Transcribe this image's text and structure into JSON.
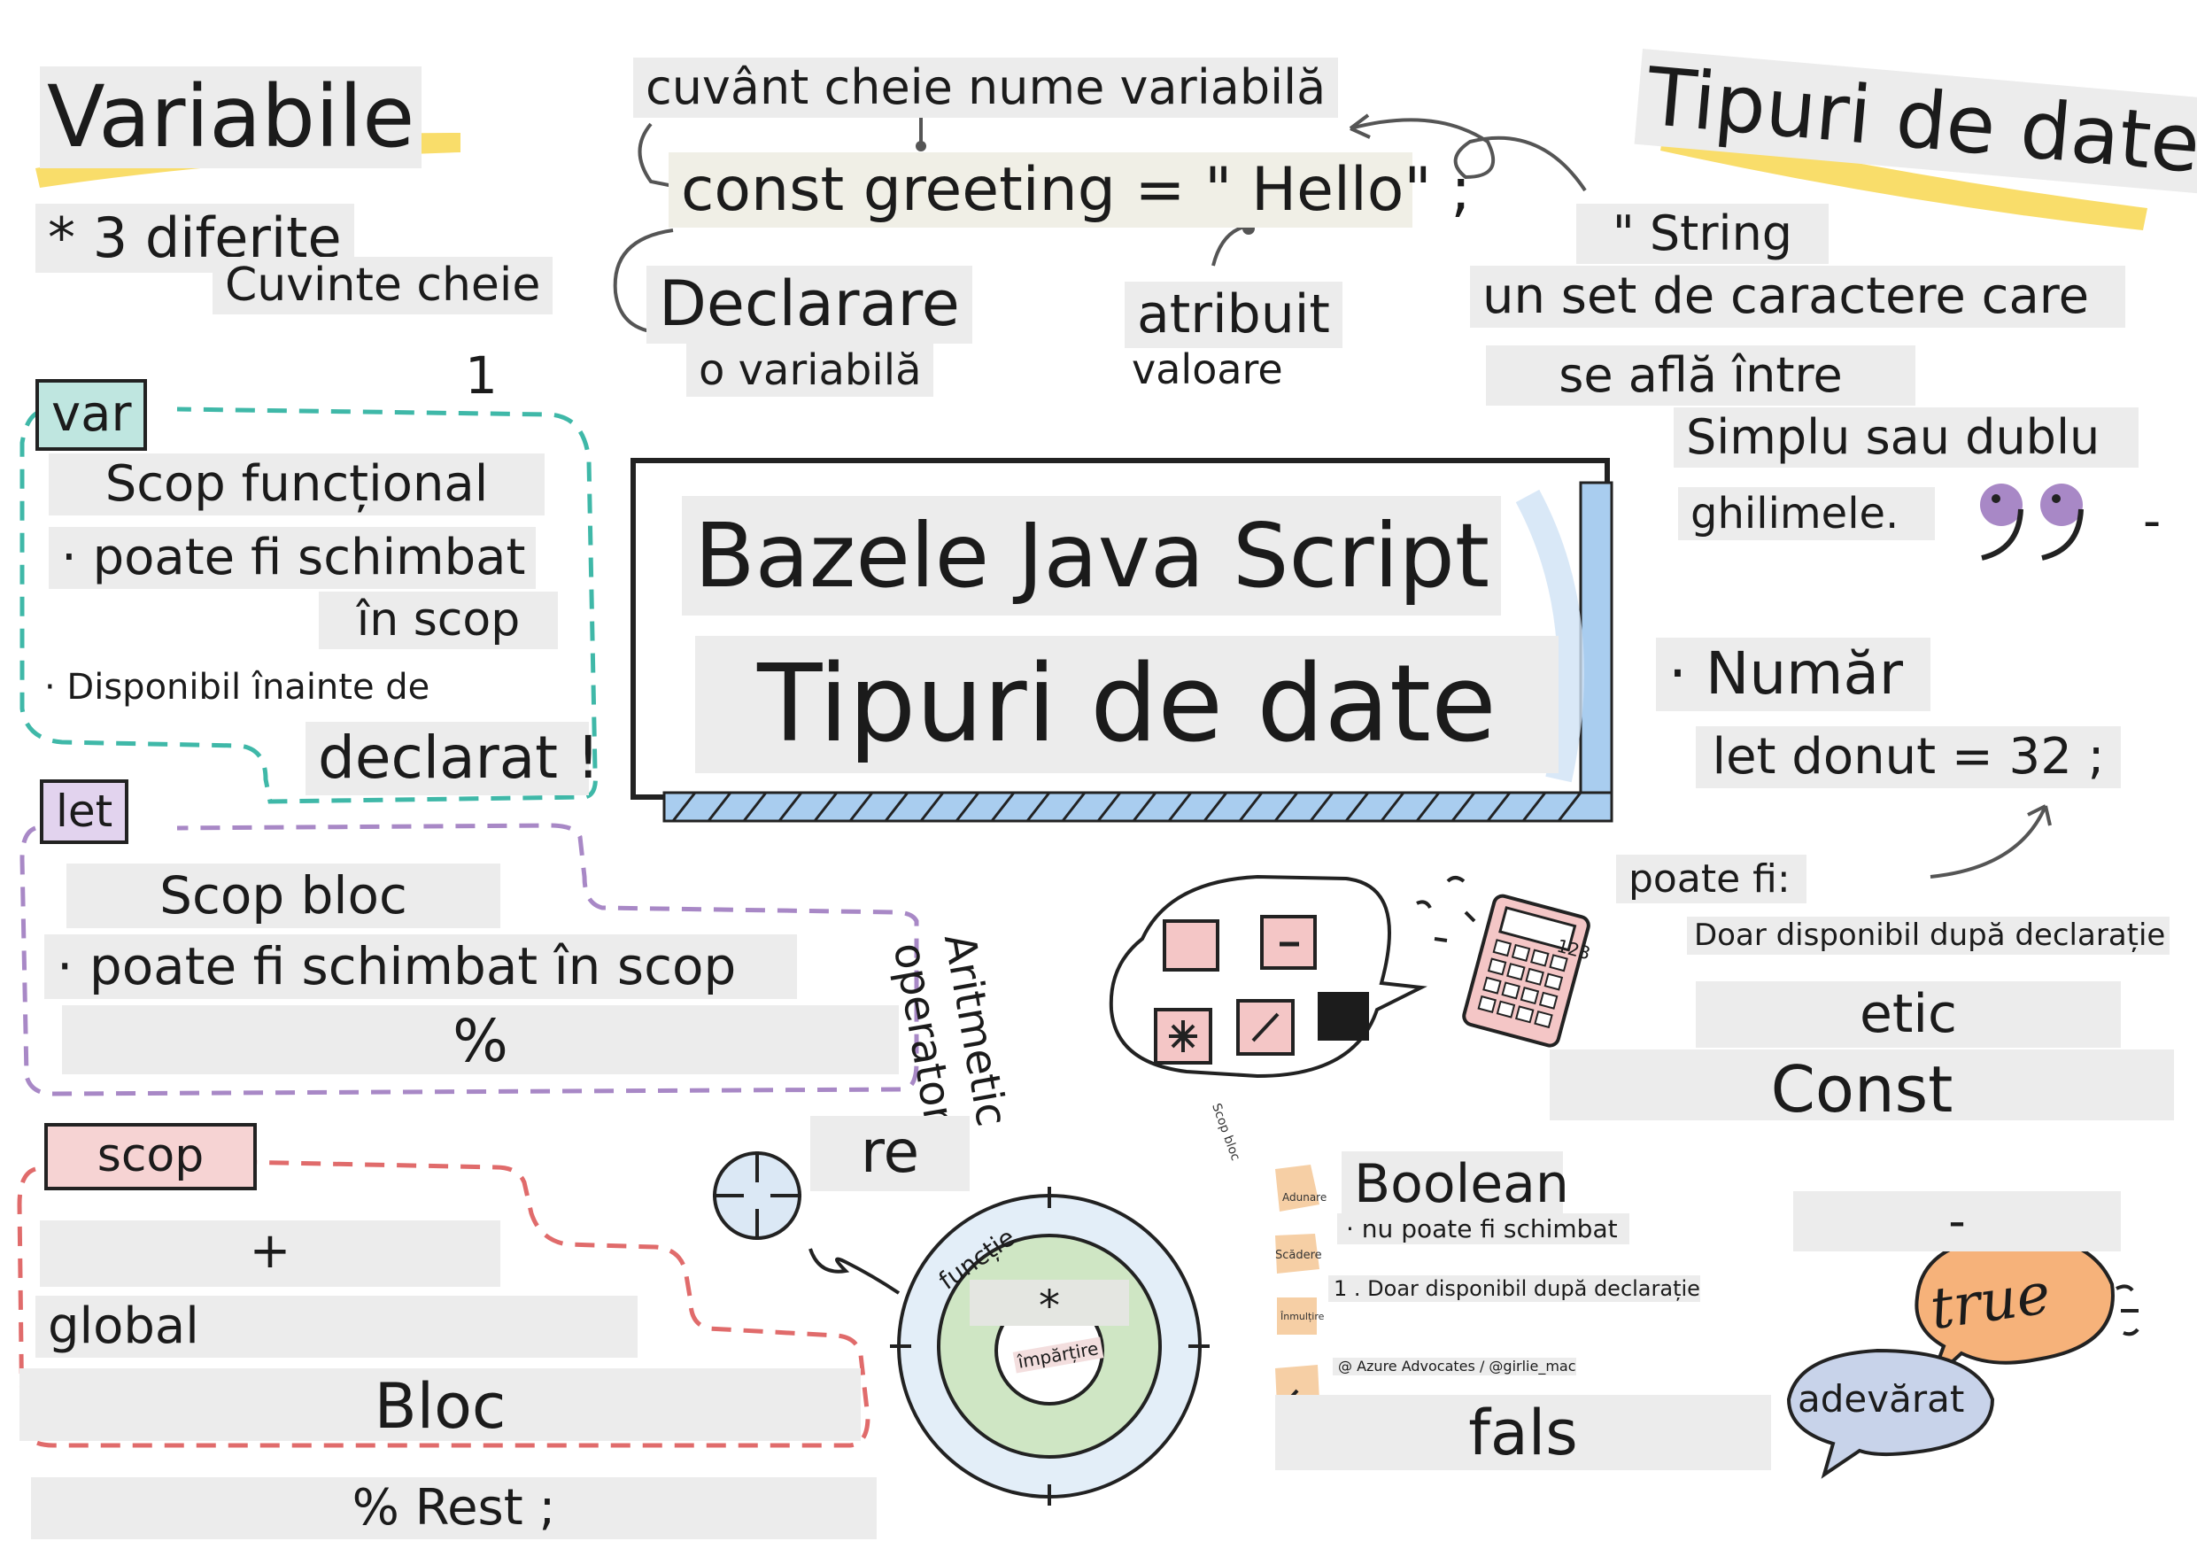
{
  "colors": {
    "teal": "#3fb8a8",
    "purple": "#a888c6",
    "red": "#e06b6b",
    "yellow_highlight": "#f9dd6a",
    "title_frame_blue": "#a9cdef",
    "label_gray": "#ececec",
    "calc_pink": "#f4c6c6",
    "bubble_orange": "#f6b27a",
    "bubble_blue": "#c8d3ea"
  },
  "left": {
    "heading": "Variabile",
    "three_different": "* 3 diferite",
    "keywords": "Cuvinte cheie",
    "one": "1",
    "var": {
      "tag": "var",
      "line1": "Scop funcțional",
      "line2": "· poate fi schimbat",
      "line3": "în scop",
      "line4": "· Disponibil înainte de",
      "line5": "declarat !"
    },
    "let": {
      "tag": "let",
      "line1": "Scop bloc",
      "line2": "· poate fi schimbat în scop",
      "line3": "%"
    },
    "scope": {
      "tag": "scop",
      "line1": "+",
      "line2": "global",
      "line3": "Bloc",
      "line4": "% Rest ;"
    }
  },
  "top": {
    "keyword_varname": "cuvânt cheie nume variabilă",
    "code": "const greeting = \" Hello\" ;",
    "declare": "Declarare",
    "a_variable": "o variabilă",
    "assign": "atribuit",
    "value": "valoare"
  },
  "center": {
    "title": "Bazele Java Script",
    "subtitle": "Tipuri de date"
  },
  "right": {
    "heading": "Tipuri de date",
    "string": "\" String",
    "string_desc1": "un set de caractere care",
    "string_desc2": "se află între",
    "string_desc3": "Simplu sau dublu",
    "string_desc4": "ghilimele.",
    "dash": "-",
    "number": "· Număr",
    "number_code": "let donut = 32 ;",
    "can_be": "poate fi:",
    "only_after": "Doar disponibil după declarație",
    "etic": "etic",
    "const": "Const",
    "dash2": "-"
  },
  "arith": {
    "label": "Aritmetic operatori",
    "label_line1": "Aritmetic",
    "label_line2": "operatori",
    "calc_display": "123",
    "keys": [
      "+",
      "−",
      "*",
      "/"
    ],
    "tiny_label": "Scop bloc",
    "re": "re",
    "function_ring": "funcție",
    "star": "*",
    "division": "împărțire"
  },
  "boolean": {
    "title": "Boolean",
    "line1": "· nu poate fi schimbat",
    "line2": "1 . Doar disponibil după declarație",
    "credit": "@ Azure Advocates / @girlie_mac",
    "side_adunare": "Adunare",
    "side_scadere": "Scădere",
    "side_inmultire": "Înmulțire",
    "false": "fals",
    "true": "true",
    "true_ro": "adevărat"
  }
}
